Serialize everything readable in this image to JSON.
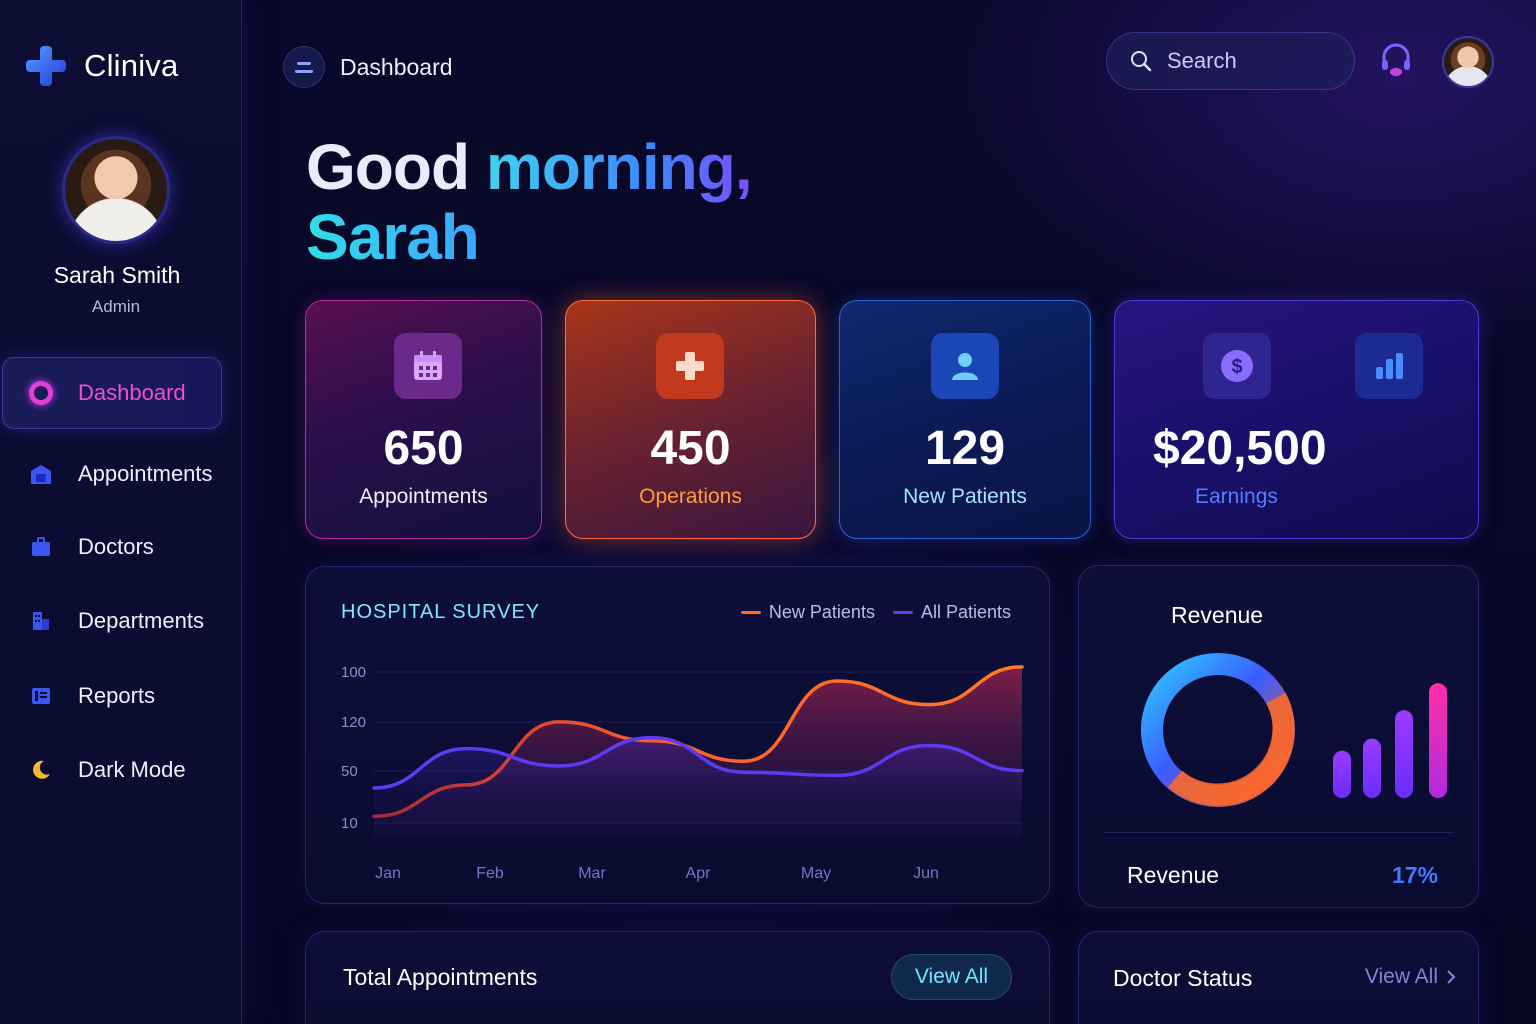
{
  "app": {
    "name": "Cliniva"
  },
  "user": {
    "name": "Sarah Smith",
    "role": "Admin"
  },
  "nav": [
    {
      "label": "Dashboard",
      "icon": "ring-icon",
      "active": true
    },
    {
      "label": "Appointments",
      "icon": "calendar-box-icon"
    },
    {
      "label": "Doctors",
      "icon": "briefcase-icon"
    },
    {
      "label": "Departments",
      "icon": "building-icon"
    },
    {
      "label": "Reports",
      "icon": "report-icon"
    },
    {
      "label": "Dark Mode",
      "icon": "moon-icon"
    }
  ],
  "topbar": {
    "breadcrumb": "Dashboard",
    "search_placeholder": "Search"
  },
  "greeting": {
    "part1": "Good ",
    "part2": "morning,",
    "name": "Sarah"
  },
  "stats": [
    {
      "value": "650",
      "label": "Appointments",
      "icon": "calendar-icon"
    },
    {
      "value": "450",
      "label": "Operations",
      "icon": "medical-cross-icon"
    },
    {
      "value": "129",
      "label": "New Patients",
      "icon": "user-icon"
    },
    {
      "value": "$20,500",
      "label": "Earnings",
      "icon": "dollar-icon"
    }
  ],
  "survey": {
    "title": "HOSPITAL SURVEY"
  },
  "chart_data": {
    "type": "area",
    "title": "HOSPITAL SURVEY",
    "categories": [
      "Jan",
      "Feb",
      "Mar",
      "Apr",
      "May",
      "Jun"
    ],
    "y_ticks": [
      "100",
      "120",
      "50",
      "10"
    ],
    "series": [
      {
        "name": "New Patients",
        "color": "#ff6a1f",
        "values": [
          10,
          30,
          70,
          58,
          45,
          96,
          81,
          105
        ]
      },
      {
        "name": "All Patients",
        "color": "#5b3cf0",
        "values": [
          28,
          53,
          42,
          60,
          38,
          36,
          55,
          39
        ]
      }
    ],
    "grid": true,
    "legend": "top-right"
  },
  "revenue": {
    "title": "Revenue",
    "footer_label": "Revenue",
    "percent": "17%",
    "bars": [
      0.35,
      0.44,
      0.65,
      0.85
    ]
  },
  "bottom": {
    "total_title": "Total Appointments",
    "total_view_all": "View All",
    "doctor_title": "Doctor Status",
    "doctor_view_all": "View All"
  }
}
